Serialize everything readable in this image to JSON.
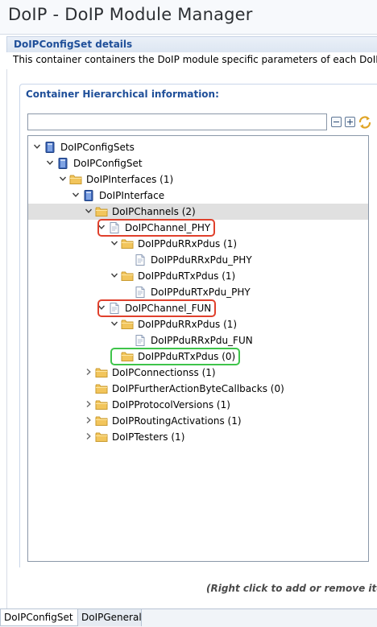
{
  "window": {
    "title": "DoIP - DoIP Module Manager"
  },
  "details": {
    "section_title": "DoIPConfigSet details",
    "description": "This container containers the DoIP module specific parameters of each DoIPConfigSet"
  },
  "hierarchy": {
    "group_title": "Container Hierarchical information:",
    "filter_value": "",
    "collapse_all_label": "Collapse All",
    "expand_all_label": "Expand All",
    "sync_label": "Link with Editor"
  },
  "tree": {
    "nodes": [
      {
        "label": "DoIPConfigSets",
        "expanded": true,
        "icon": "module-icon"
      },
      {
        "label": "DoIPConfigSet",
        "expanded": true,
        "icon": "module-icon"
      },
      {
        "label": "DoIPInterfaces (1)",
        "expanded": true,
        "icon": "folder-icon"
      },
      {
        "label": "DoIPInterface",
        "expanded": true,
        "icon": "module-icon"
      },
      {
        "label": "DoIPChannels (2)",
        "expanded": true,
        "icon": "folder-icon",
        "selected": true
      },
      {
        "label": "DoIPChannel_PHY",
        "expanded": true,
        "icon": "file-icon",
        "highlight": "red"
      },
      {
        "label": "DoIPPduRRxPdus (1)",
        "expanded": true,
        "icon": "folder-icon"
      },
      {
        "label": "DoIPPduRRxPdu_PHY",
        "icon": "file-icon"
      },
      {
        "label": "DoIPPduRTxPdus (1)",
        "expanded": true,
        "icon": "folder-icon"
      },
      {
        "label": "DoIPPduRTxPdu_PHY",
        "icon": "file-icon"
      },
      {
        "label": "DoIPChannel_FUN",
        "expanded": true,
        "icon": "file-icon",
        "highlight": "red"
      },
      {
        "label": "DoIPPduRRxPdus (1)",
        "expanded": true,
        "icon": "folder-icon"
      },
      {
        "label": "DoIPPduRRxPdu_FUN",
        "icon": "file-icon"
      },
      {
        "label": "DoIPPduRTxPdus (0)",
        "icon": "folder-icon",
        "highlight": "green"
      },
      {
        "label": "DoIPConnectionss (1)",
        "expanded": false,
        "icon": "folder-icon"
      },
      {
        "label": "DoIPFurtherActionByteCallbacks (0)",
        "icon": "folder-icon"
      },
      {
        "label": "DoIPProtocolVersions (1)",
        "expanded": false,
        "icon": "folder-icon"
      },
      {
        "label": "DoIPRoutingActivations (1)",
        "expanded": false,
        "icon": "folder-icon"
      },
      {
        "label": "DoIPTesters (1)",
        "expanded": false,
        "icon": "folder-icon"
      }
    ]
  },
  "footer": {
    "hint": "(Right click to add or remove items)"
  },
  "tabs": [
    {
      "label": "DoIPConfigSet",
      "active": true
    },
    {
      "label": "DoIPGeneral",
      "active": false
    }
  ],
  "colors": {
    "accent": "#1f4f99",
    "highlight_red": "#e0402c",
    "highlight_green": "#3ec44a",
    "folder": "#f2c55c",
    "selection": "#e0e0e0"
  }
}
